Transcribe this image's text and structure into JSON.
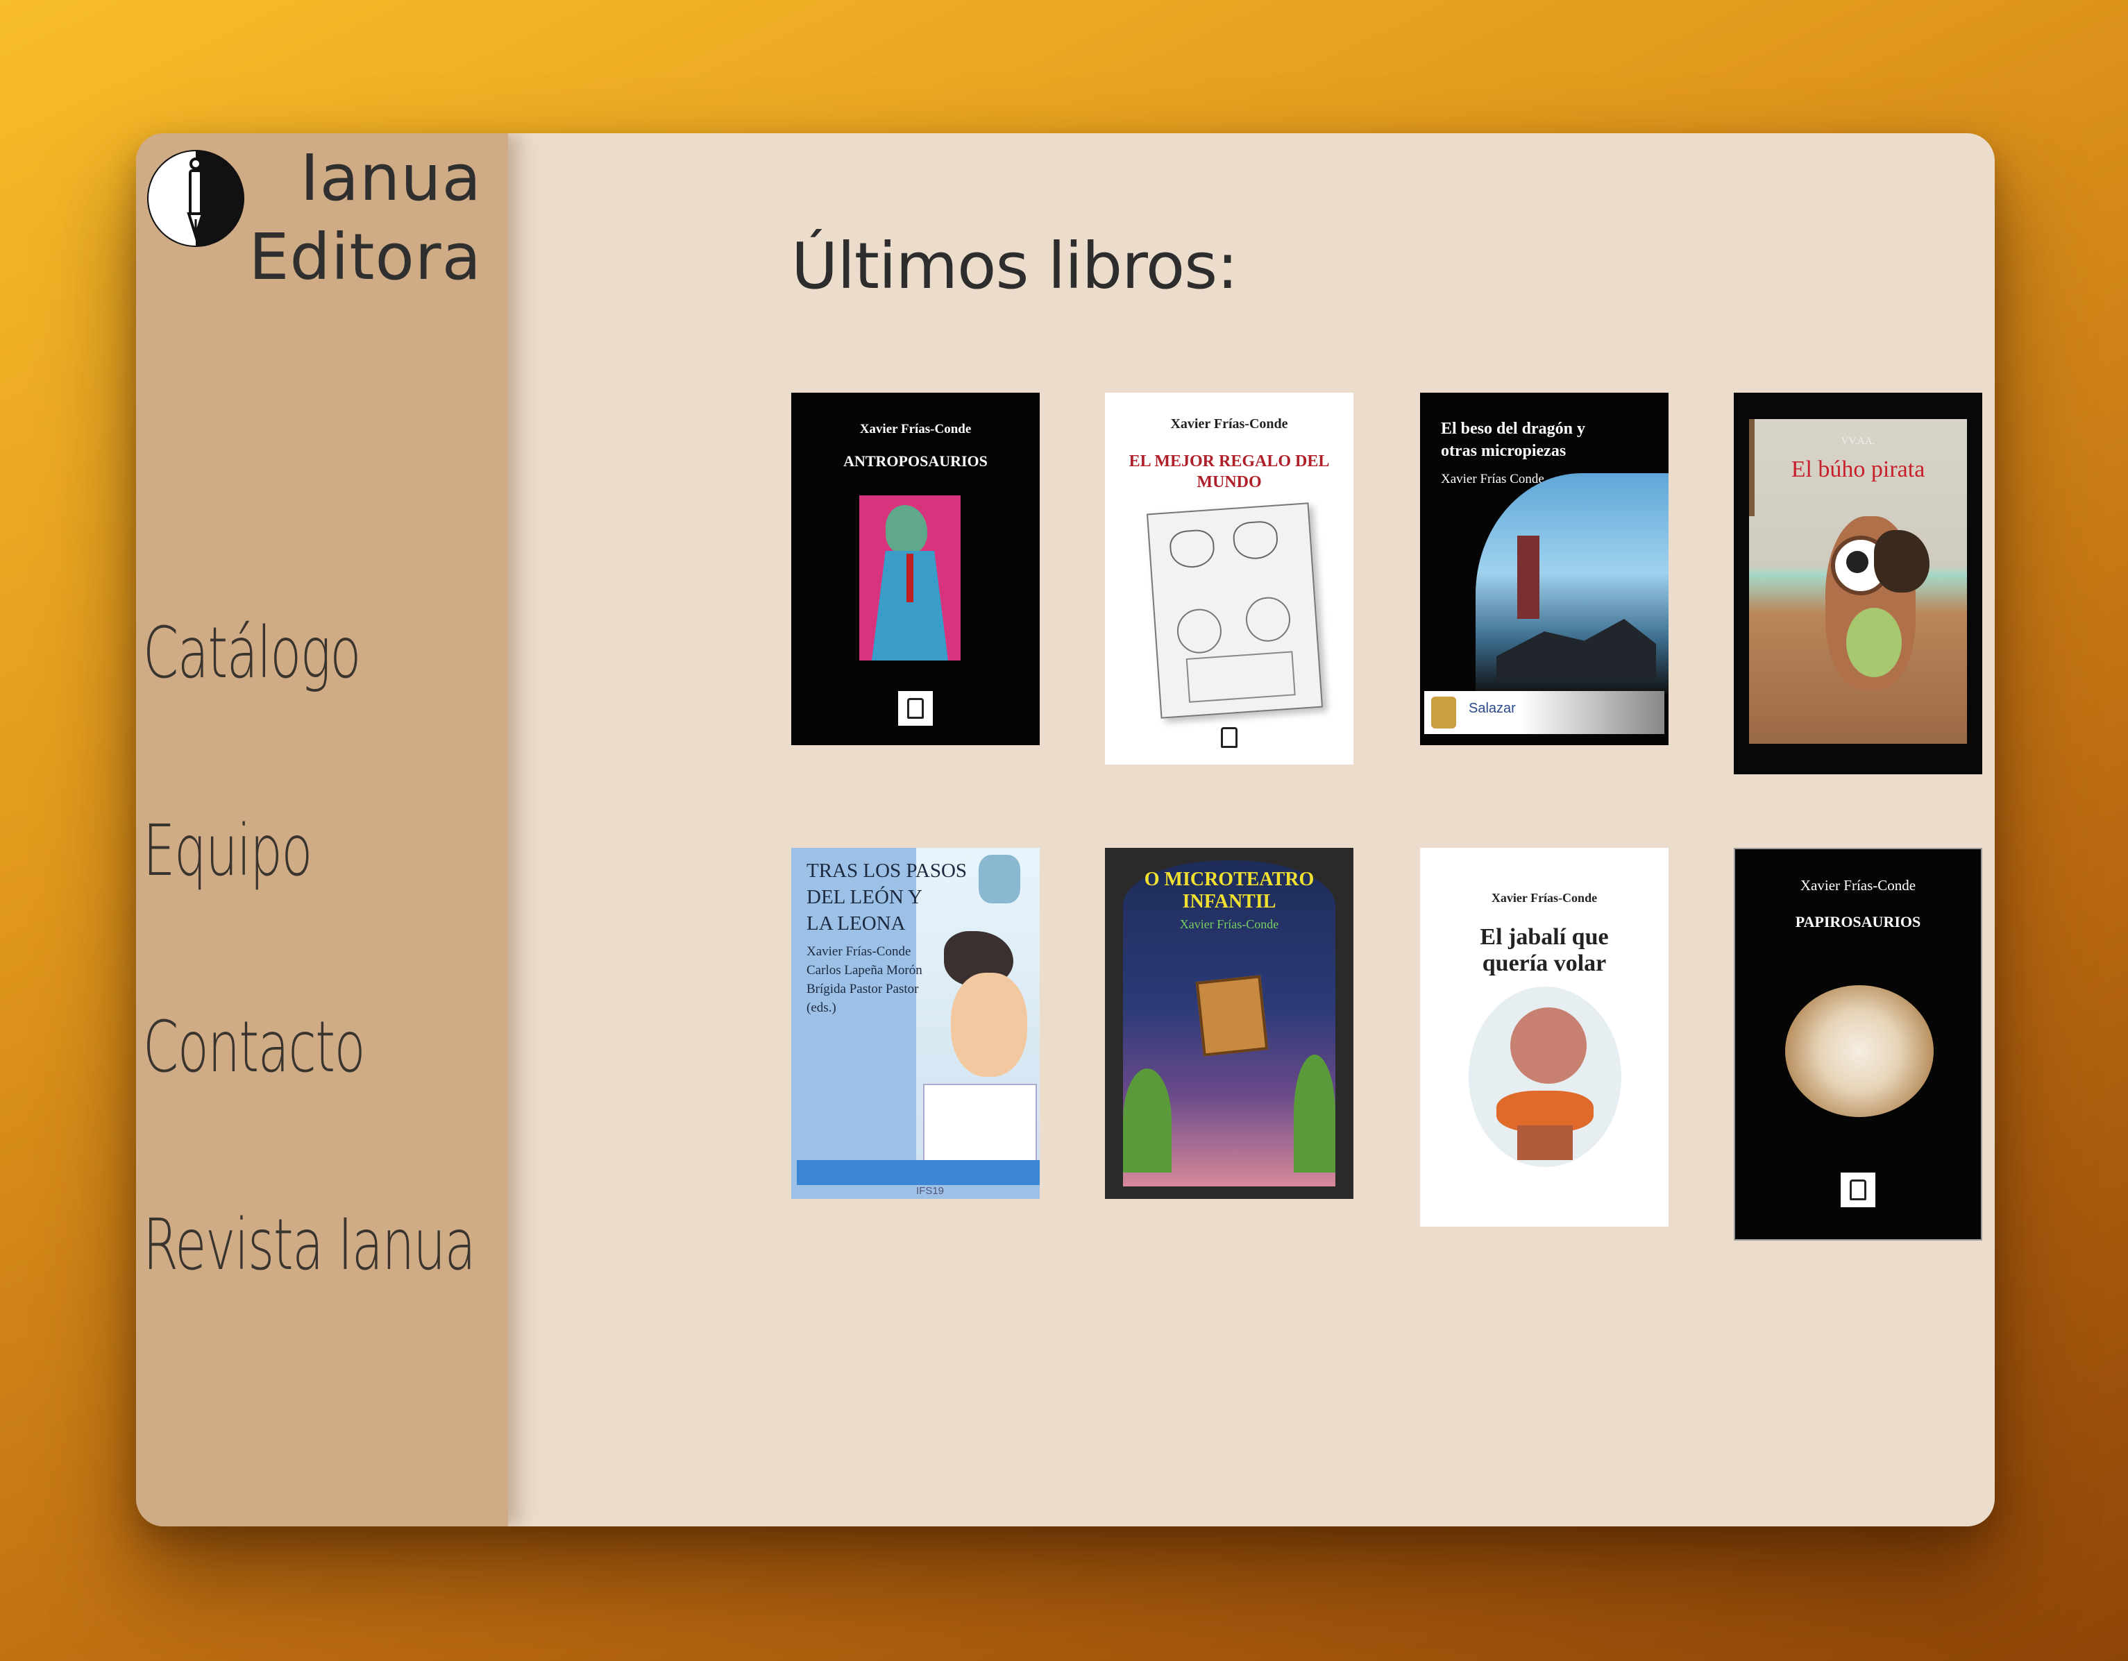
{
  "brand": {
    "line1": "Ianua",
    "line2": "Editora",
    "logo_icon": "fountain-pen-logo-icon"
  },
  "nav": {
    "items": [
      {
        "label": "Catálogo"
      },
      {
        "label": "Equipo"
      },
      {
        "label": "Contacto"
      },
      {
        "label": "Revista Ianua"
      }
    ]
  },
  "main": {
    "heading": "Últimos libros:"
  },
  "books": [
    {
      "author": "Xavier Frías-Conde",
      "title": "ANTROPOSAURIOS"
    },
    {
      "author": "Xavier Frías-Conde",
      "title": "EL MEJOR REGALO DEL MUNDO"
    },
    {
      "title_line1": "El beso del dragón y",
      "title_line2": "otras micropiezas",
      "author": "Xavier Frías Conde",
      "footer_text": "Salazar"
    },
    {
      "author": "VV.AA.",
      "title": "El búho pirata"
    },
    {
      "title_line1": "TRAS LOS PASOS",
      "title_line2": "DEL LEÓN Y",
      "title_line3": "LA LEONA",
      "authors": [
        "Xavier Frías-Conde",
        "Carlos Lapeña Morón",
        "Brígida Pastor Pastor",
        "(eds.)"
      ],
      "code": "IFS19"
    },
    {
      "title_line1": "O MICROTEATRO",
      "title_line2": "INFANTIL",
      "author": "Xavier Frías-Conde"
    },
    {
      "author": "Xavier Frías-Conde",
      "title_line1": "El jabalí que",
      "title_line2": "quería volar"
    },
    {
      "author": "Xavier Frías-Conde",
      "title": "PAPIROSAURIOS"
    }
  ],
  "colors": {
    "sidebar": "#cfab86",
    "content": "#ecdccb",
    "text": "#2f2f2f"
  }
}
